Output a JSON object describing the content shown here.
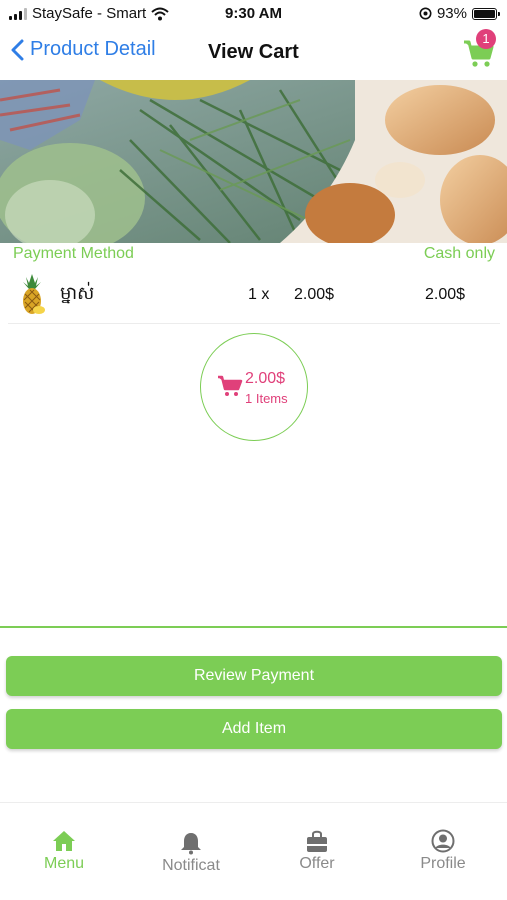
{
  "status_bar": {
    "carrier": "StaySafe - Smart",
    "time": "9:30 AM",
    "battery": "93%"
  },
  "nav": {
    "back_label": "Product Detail",
    "title": "View Cart",
    "cart_badge": "1"
  },
  "payment": {
    "label": "Payment Method",
    "value": "Cash only"
  },
  "cart_items": [
    {
      "name": "ម្នាស់",
      "qty": "1 x",
      "price": "2.00$",
      "total": "2.00$"
    }
  ],
  "summary": {
    "amount": "2.00$",
    "items": "1 Items"
  },
  "actions": {
    "review_payment": "Review Payment",
    "add_item": "Add Item"
  },
  "tabs": [
    {
      "label": "Menu",
      "icon": "home-icon",
      "active": true
    },
    {
      "label": "Notificat",
      "icon": "bell-icon",
      "active": false
    },
    {
      "label": "Offer",
      "icon": "shopping-bag-icon",
      "active": false
    },
    {
      "label": "Profile",
      "icon": "user-circle-icon",
      "active": false
    }
  ],
  "colors": {
    "accent_green": "#7ccd55",
    "accent_pink": "#e0407a",
    "link_blue": "#2f7ee6"
  }
}
